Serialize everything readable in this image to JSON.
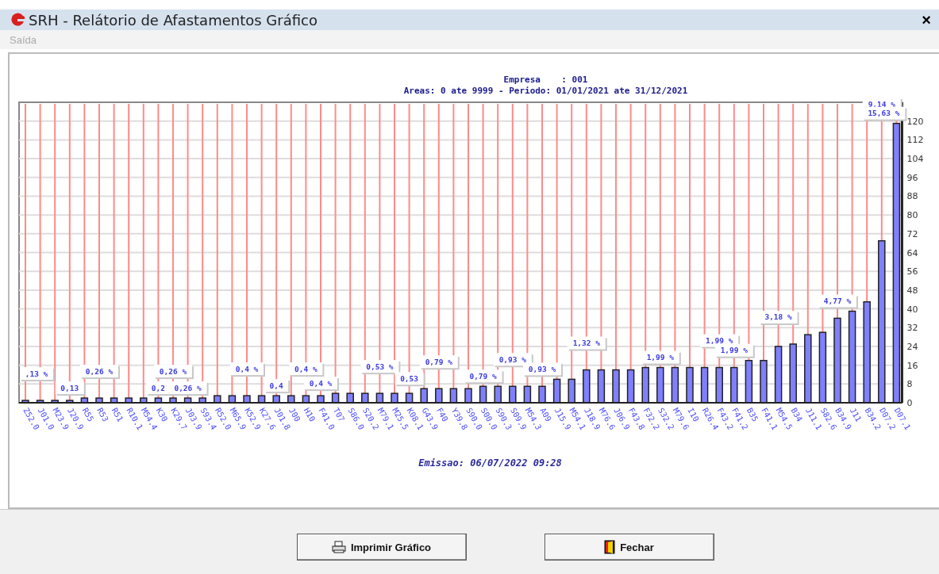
{
  "window": {
    "title": "SRH - Relátorio de Afastamentos Gráfico",
    "close": "×"
  },
  "menu": [
    {
      "label": "Saída",
      "disabled": true
    }
  ],
  "report": {
    "header": [
      "Empresa    : 001",
      "Areas: 0 ate 9999 - Periodo: 01/01/2021 ate 31/12/2021"
    ],
    "chart_data": {
      "type": "bar",
      "categories": [
        "Z52.0",
        "J01.0",
        "M23.9",
        "J20.9",
        "R55",
        "R53",
        "R51",
        "R10.1",
        "M54.4",
        "K30",
        "K29.7",
        "J03.9",
        "S93.4",
        "R52.0",
        "M65.9",
        "K52.9",
        "K27.6",
        "J01.8",
        "J00",
        "H10",
        "F41.0",
        "T07",
        "S86.0",
        "S20.2",
        "M79.1",
        "M25.5",
        "K08.1",
        "G43.9",
        "F40",
        "Y39.8",
        "S90.0",
        "S00.0",
        "S90.3",
        "S09.9",
        "M54.3",
        "A09",
        "J15.9",
        "M54.1",
        "J18.9",
        "M76.6",
        "J06.9",
        "F43.8",
        "F32.2",
        "S32.2",
        "M79.6",
        "I10",
        "R26.4",
        "F43.2",
        "F41.2",
        "B35",
        "F41.1",
        "M54.5",
        "B34",
        "J11.1",
        "S82.6",
        "B34.9",
        "J11",
        "B34.2",
        "D07.2",
        "D07.1"
      ],
      "series": [
        {
          "color": "#8080ff",
          "values": [
            1,
            1,
            1,
            1,
            2,
            2,
            2,
            2,
            2,
            2,
            2,
            2,
            2,
            3,
            3,
            3,
            3,
            3,
            3,
            3,
            3,
            4,
            4,
            4,
            4,
            4,
            4,
            6,
            6,
            6,
            6,
            7,
            7,
            7,
            7,
            7,
            10,
            10,
            14,
            14,
            14,
            14,
            15,
            15,
            15,
            15,
            15,
            15,
            15,
            18,
            18,
            24,
            25,
            29,
            30,
            36,
            39,
            43,
            69,
            119
          ]
        }
      ],
      "grid": true,
      "ylim": [
        0,
        128
      ],
      "yticks": [
        0,
        8,
        16,
        24,
        32,
        40,
        48,
        56,
        64,
        72,
        80,
        88,
        96,
        104,
        112,
        120
      ],
      "value_labels": [
        ",13 %",
        null,
        null,
        "0,13",
        null,
        "0,26 %",
        null,
        null,
        null,
        "0,2",
        "0,26 %",
        "0,26 %",
        null,
        null,
        null,
        "0,4 %",
        null,
        "0,4",
        null,
        "0,4 %",
        "0,4 %",
        null,
        null,
        null,
        "0,53 %",
        null,
        "0,53",
        null,
        "0,79 %",
        null,
        null,
        "0,79 %",
        null,
        "0,93 %",
        null,
        "0,93 %",
        null,
        null,
        "1,32 %",
        null,
        null,
        null,
        null,
        "1,99 %",
        null,
        null,
        null,
        "1,99 %",
        "1,99 %",
        null,
        null,
        "3,18 %",
        null,
        null,
        null,
        "4,77 %",
        null,
        null,
        "9,14 %",
        "15,63 %"
      ]
    },
    "footer": "Emissao: 06/07/2022 09:28"
  },
  "buttons": [
    {
      "label": "Imprimir Gráfico"
    },
    {
      "label": "Fechar"
    }
  ]
}
